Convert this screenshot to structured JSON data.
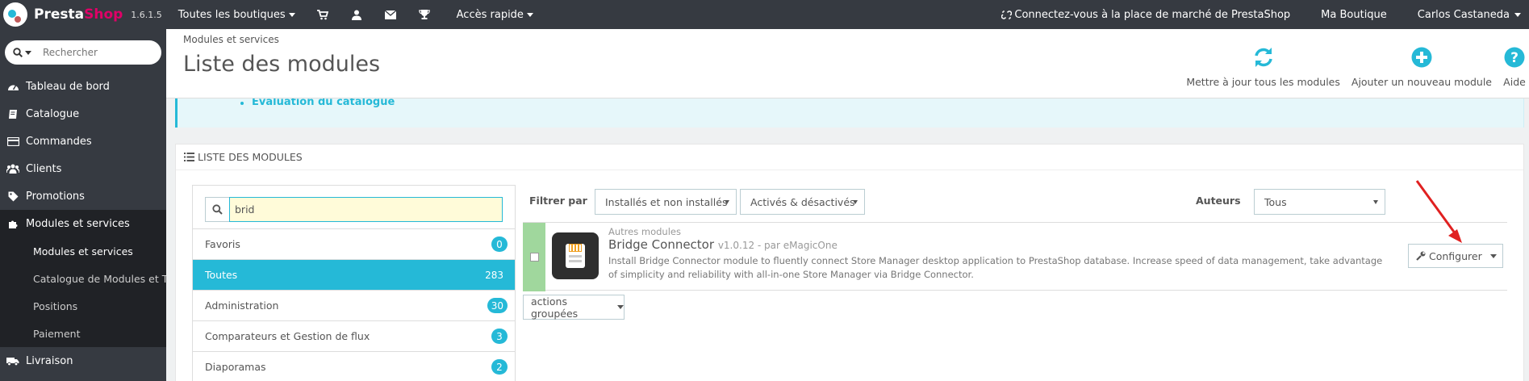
{
  "topbar": {
    "brand_presta": "Presta",
    "brand_shop": "Shop",
    "version": "1.6.1.5",
    "shops": "Toutes les boutiques",
    "quick_access": "Accès rapide",
    "marketplace": "Connectez-vous à la place de marché de PrestaShop",
    "my_shop": "Ma Boutique",
    "user": "Carlos Castaneda"
  },
  "sidebar": {
    "search_placeholder": "Rechercher",
    "items": [
      {
        "label": "Tableau de bord",
        "icon": "dashboard-icon"
      },
      {
        "label": "Catalogue",
        "icon": "book-icon"
      },
      {
        "label": "Commandes",
        "icon": "credit-card-icon"
      },
      {
        "label": "Clients",
        "icon": "users-icon"
      },
      {
        "label": "Promotions",
        "icon": "tag-icon"
      },
      {
        "label": "Modules et services",
        "icon": "puzzle-icon"
      }
    ],
    "subitems": [
      {
        "label": "Modules et services"
      },
      {
        "label": "Catalogue de Modules et T..."
      },
      {
        "label": "Positions"
      },
      {
        "label": "Paiement"
      }
    ],
    "after": {
      "label": "Livraison",
      "icon": "truck-icon"
    }
  },
  "header": {
    "breadcrumb": "Modules et services",
    "title": "Liste des modules",
    "toolbar": {
      "update_all": "Mettre à jour tous les modules",
      "add_new": "Ajouter un nouveau module",
      "help": "Aide"
    }
  },
  "info": {
    "item": "Évaluation du catalogue"
  },
  "panel": {
    "title": "LISTE DES MODULES",
    "search_value": "brid",
    "categories": [
      {
        "label": "Favoris",
        "count": "0"
      },
      {
        "label": "Toutes",
        "count": "283"
      },
      {
        "label": "Administration",
        "count": "30"
      },
      {
        "label": "Comparateurs et Gestion de flux",
        "count": "3"
      },
      {
        "label": "Diaporamas",
        "count": "2"
      }
    ],
    "filter": {
      "label": "Filtrer par",
      "install_select": "Installés et non installés",
      "active_select": "Activés & désactivés",
      "authors_label": "Auteurs",
      "authors_select": "Tous"
    },
    "module": {
      "category": "Autres modules",
      "name": "Bridge Connector",
      "version": "v1.0.12 - par eMagicOne",
      "description": "Install Bridge Connector module to fluently connect Store Manager desktop application to PrestaShop database. Increase speed of data management, take advantage of simplicity and reliability with all-in-one Store Manager via Bridge Connector.",
      "configure": "Configurer"
    },
    "bulk_actions": "actions groupées"
  },
  "colors": {
    "accent": "#25b9d7",
    "sidebar_bg": "#363a41",
    "installed": "#a0d79d",
    "annotation_arrow": "#e02020"
  }
}
